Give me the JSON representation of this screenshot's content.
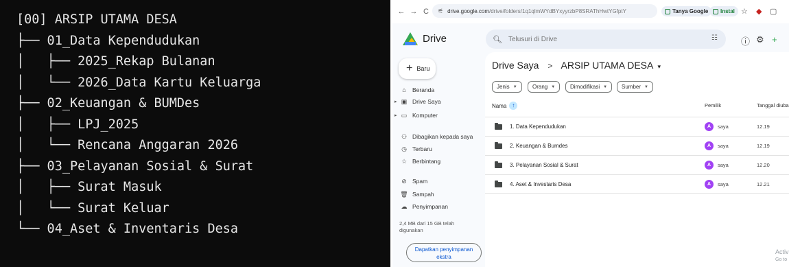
{
  "terminal": {
    "lines": [
      "[00] ARSIP UTAMA DESA",
      "├── 01_Data Kependudukan",
      "│   ├── 2025_Rekap Bulanan",
      "│   └── 2026_Data Kartu Keluarga",
      "├── 02_Keuangan & BUMDes",
      "│   ├── LPJ_2025",
      "│   └── Rencana Anggaran 2026",
      "├── 03_Pelayanan Sosial & Surat",
      "│   ├── Surat Masuk",
      "│   └── Surat Keluar",
      "└── 04_Aset & Inventaris Desa"
    ]
  },
  "browser": {
    "nav": {
      "back": "←",
      "forward": "→",
      "reload": "C"
    },
    "url_host": "drive.google.com",
    "url_path": "/drive/folders/1q1qlmWYdBYxyyrzbP8SRAThHwtYGfptY",
    "chips": {
      "ask_google": "Tanya Google",
      "install": "Instal"
    }
  },
  "drive": {
    "app_name": "Drive",
    "search": {
      "placeholder": "Telusuri di Drive"
    },
    "new_button": "Baru",
    "sidebar": {
      "items": [
        {
          "label": "Beranda",
          "icon": "home-icon"
        },
        {
          "label": "Drive Saya",
          "icon": "my-drive-icon"
        },
        {
          "label": "Komputer",
          "icon": "computer-icon"
        },
        {
          "label": "Dibagikan kepada saya",
          "icon": "shared-icon"
        },
        {
          "label": "Terbaru",
          "icon": "clock-icon"
        },
        {
          "label": "Berbintang",
          "icon": "star-icon"
        },
        {
          "label": "Spam",
          "icon": "spam-icon"
        },
        {
          "label": "Sampah",
          "icon": "trash-icon"
        },
        {
          "label": "Penyimpanan",
          "icon": "cloud-icon"
        }
      ],
      "storage_text": "2,4 MB dari 15 GB telah digunakan",
      "storage_button": "Dapatkan penyimpanan ekstra"
    },
    "breadcrumb": {
      "root": "Drive Saya",
      "separator": ">",
      "current": "ARSIP UTAMA DESA"
    },
    "filters": [
      "Jenis",
      "Orang",
      "Dimodifikasi",
      "Sumber"
    ],
    "columns": {
      "name": "Nama",
      "owner": "Pemilik",
      "modified": "Tanggal diubah"
    },
    "rows": [
      {
        "name": "1. Data Kependudukan",
        "owner_initial": "A",
        "owner": "saya",
        "modified": "12.19"
      },
      {
        "name": "2. Keuangan & Bumdes",
        "owner_initial": "A",
        "owner": "saya",
        "modified": "12.19"
      },
      {
        "name": "3. Pelayanan Sosial & Surat",
        "owner_initial": "A",
        "owner": "saya",
        "modified": "12.20"
      },
      {
        "name": "4. Aset & Investaris Desa",
        "owner_initial": "A",
        "owner": "saya",
        "modified": "12.21"
      }
    ],
    "watermark": {
      "line1": "Activ",
      "line2": "Go to"
    }
  }
}
